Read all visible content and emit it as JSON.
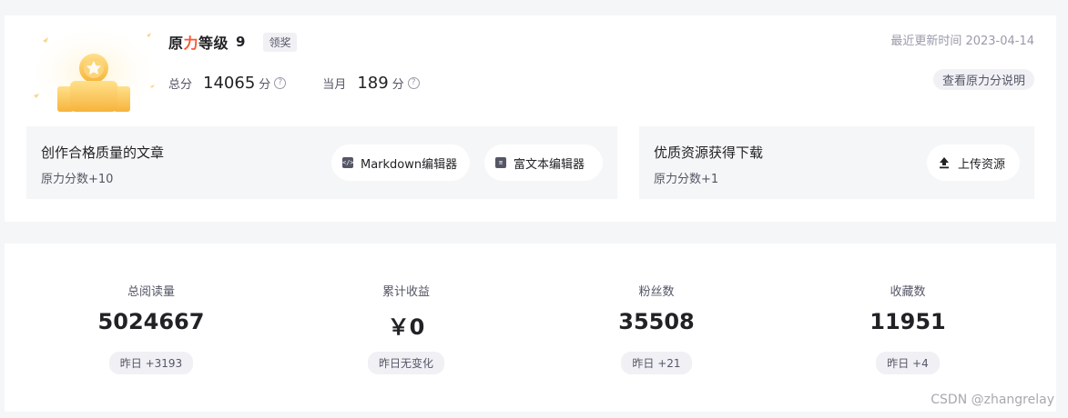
{
  "level": {
    "title_part1": "原",
    "title_accent": "力",
    "title_part2": "等级",
    "value": "9",
    "badge": "领奖",
    "update_time": "最近更新时间 2023-04-14",
    "explain_label": "查看原力分说明"
  },
  "score": {
    "total_label": "总分",
    "total_value": "14065",
    "total_unit": "分",
    "month_label": "当月",
    "month_value": "189",
    "month_unit": "分"
  },
  "tasks": {
    "write": {
      "title": "创作合格质量的文章",
      "desc": "原力分数+10",
      "markdown_label": "Markdown编辑器",
      "richtext_label": "富文本编辑器"
    },
    "upload": {
      "title": "优质资源获得下载",
      "desc": "原力分数+1",
      "upload_label": "上传资源"
    }
  },
  "stats": [
    {
      "label": "总阅读量",
      "value": "5024667",
      "change": "昨日 +3193"
    },
    {
      "label": "累计收益",
      "value": "￥0",
      "change": "昨日无变化"
    },
    {
      "label": "粉丝数",
      "value": "35508",
      "change": "昨日 +21"
    },
    {
      "label": "收藏数",
      "value": "11951",
      "change": "昨日 +4"
    }
  ],
  "watermark": "CSDN @zhangrelay",
  "colors": {
    "accent": "#fc5531",
    "medal_gold": "#f8c35a"
  }
}
